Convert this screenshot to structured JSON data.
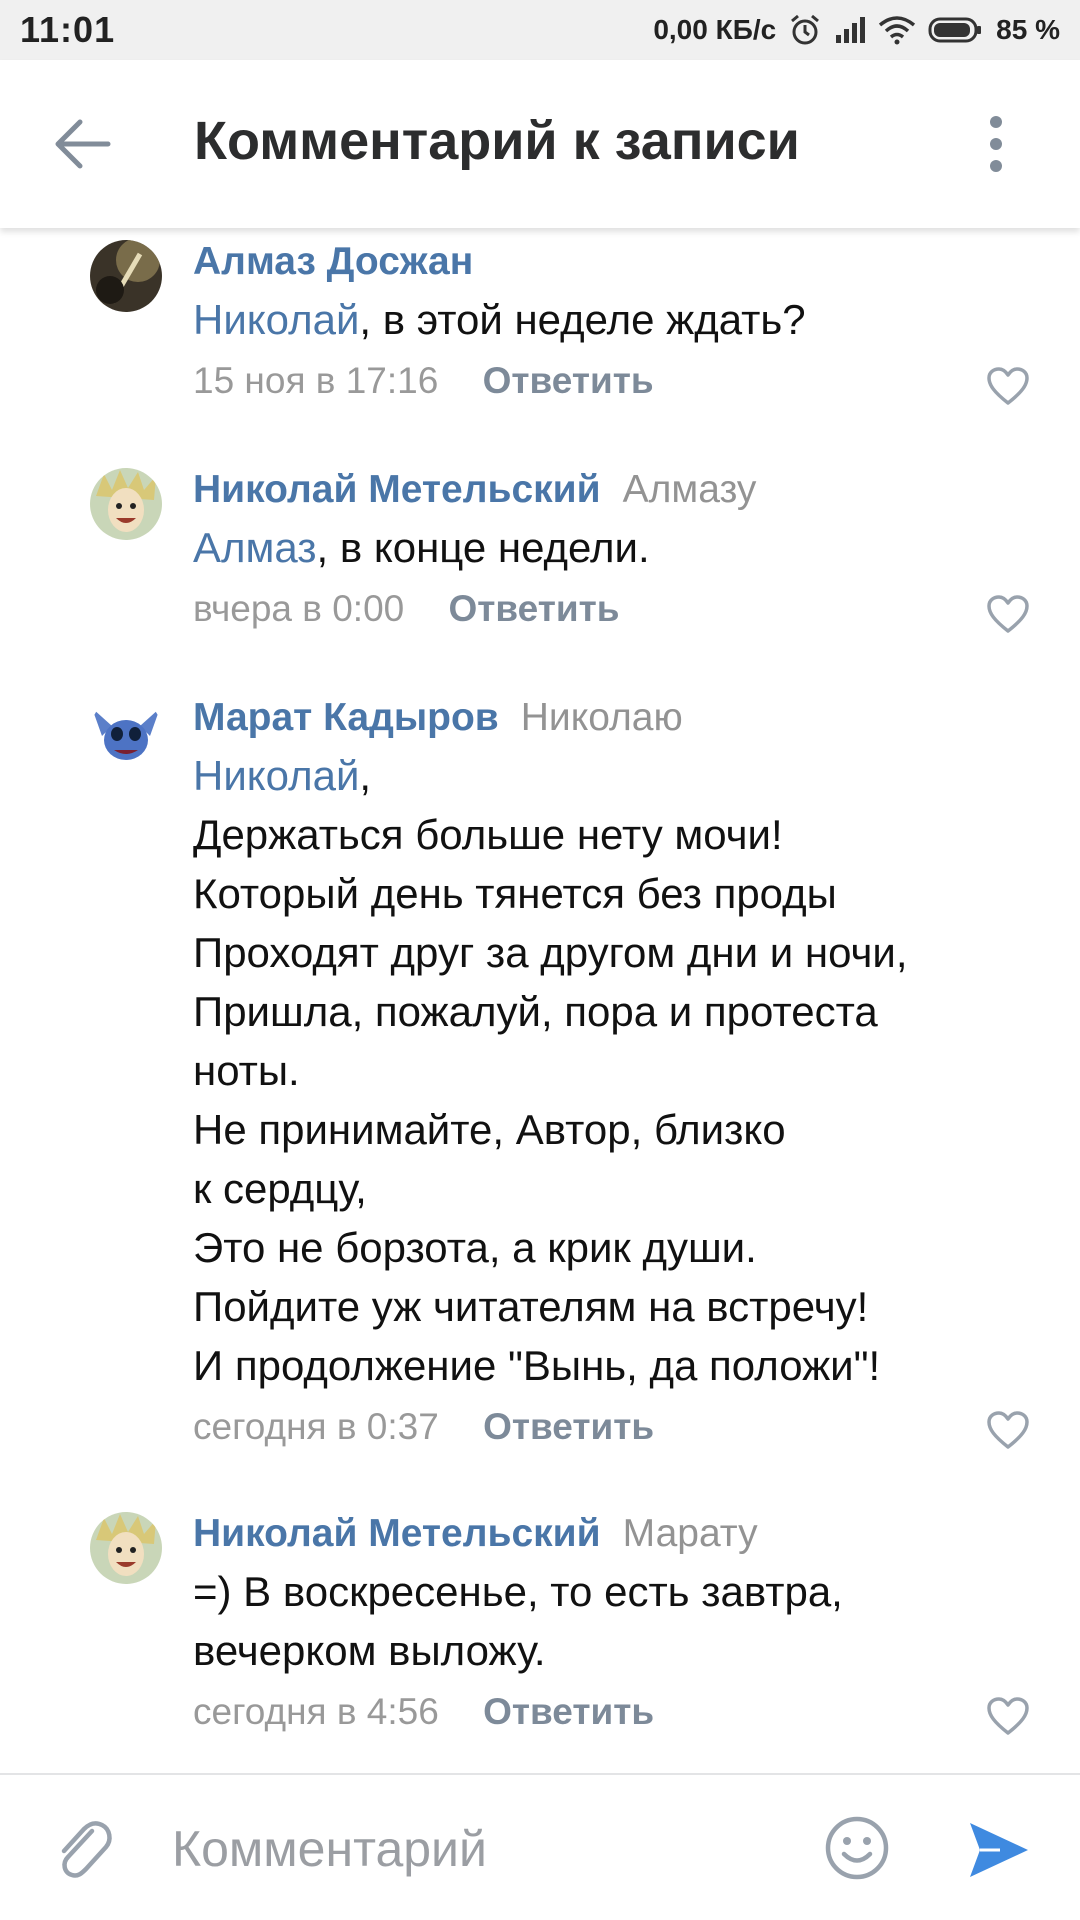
{
  "status_bar": {
    "time": "11:01",
    "net_speed": "0,00 КБ/с",
    "battery": "85 %"
  },
  "header": {
    "title": "Комментарий к записи"
  },
  "comments": [
    {
      "author": "Алмаз Досжан",
      "reply_to": "",
      "mention": "Николай",
      "lines": [
        ",  в этой неделе ждать?"
      ],
      "date": "15 ноя в 17:16",
      "reply_label": "Ответить"
    },
    {
      "author": "Николай Метельский",
      "reply_to": "Алмазу",
      "mention": "Алмаз",
      "lines": [
        ", в конце недели."
      ],
      "date": "вчера в 0:00",
      "reply_label": "Ответить"
    },
    {
      "author": "Марат Кадыров",
      "reply_to": "Николаю",
      "mention": "Николай",
      "lines": [
        ",",
        "Держаться больше нету мочи!",
        "Который день тянется без проды",
        "Проходят друг за другом дни и ночи,",
        "Пришла, пожалуй, пора и протеста",
        "ноты.",
        "Не принимайте, Автор, близко",
        "к сердцу,",
        "Это не борзота, а крик души.",
        "Пойдите уж читателям на встречу!",
        "И продолжение \"Вынь, да положи\"!"
      ],
      "date": "сегодня в 0:37",
      "reply_label": "Ответить"
    },
    {
      "author": "Николай Метельский",
      "reply_to": "Марату",
      "mention": "",
      "lines": [
        "=) В воскресенье, то есть завтра,",
        "вечерком выложу."
      ],
      "date": "сегодня в 4:56",
      "reply_label": "Ответить"
    }
  ],
  "input": {
    "placeholder": "Комментарий"
  },
  "colors": {
    "accent": "#4a76a8",
    "meta": "#999999",
    "reply": "#7d8a99",
    "send": "#3f8ae0"
  },
  "icons": [
    "back-arrow-icon",
    "more-vertical-icon",
    "heart-icon",
    "paperclip-icon",
    "smile-icon",
    "send-icon"
  ]
}
